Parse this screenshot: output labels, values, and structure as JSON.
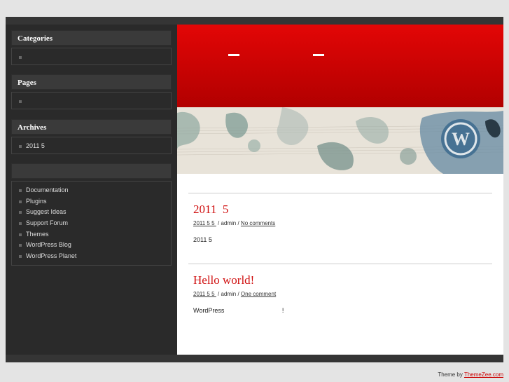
{
  "sidebar": {
    "categories": {
      "title": "Categories",
      "items": [
        ""
      ]
    },
    "pages": {
      "title": "Pages",
      "items": [
        ""
      ]
    },
    "archives": {
      "title": "Archives",
      "items": [
        "2011 5"
      ]
    },
    "links": {
      "title": "",
      "items": [
        "Documentation",
        "Plugins",
        "Suggest Ideas",
        "Support Forum",
        "Themes",
        "WordPress Blog",
        "WordPress Planet"
      ]
    }
  },
  "posts": [
    {
      "title": "2011  5",
      "date": "2011 5 5 ",
      "separator1": " / ",
      "author": "admin",
      "separator2": " / ",
      "comments": "No comments",
      "body": "2011 5"
    },
    {
      "title": "Hello world!",
      "date": "2011 5 5 ",
      "separator1": " / ",
      "author": "admin",
      "separator2": " / ",
      "comments": "One comment",
      "body": "WordPress                                 !"
    }
  ],
  "footer": {
    "prefix": "Theme by ",
    "link": "ThemeZee.com"
  },
  "colors": {
    "accent": "#d01010",
    "header_top": "#e30606",
    "header_bottom": "#b10000",
    "sidebar_bg": "#2a2a2a"
  }
}
